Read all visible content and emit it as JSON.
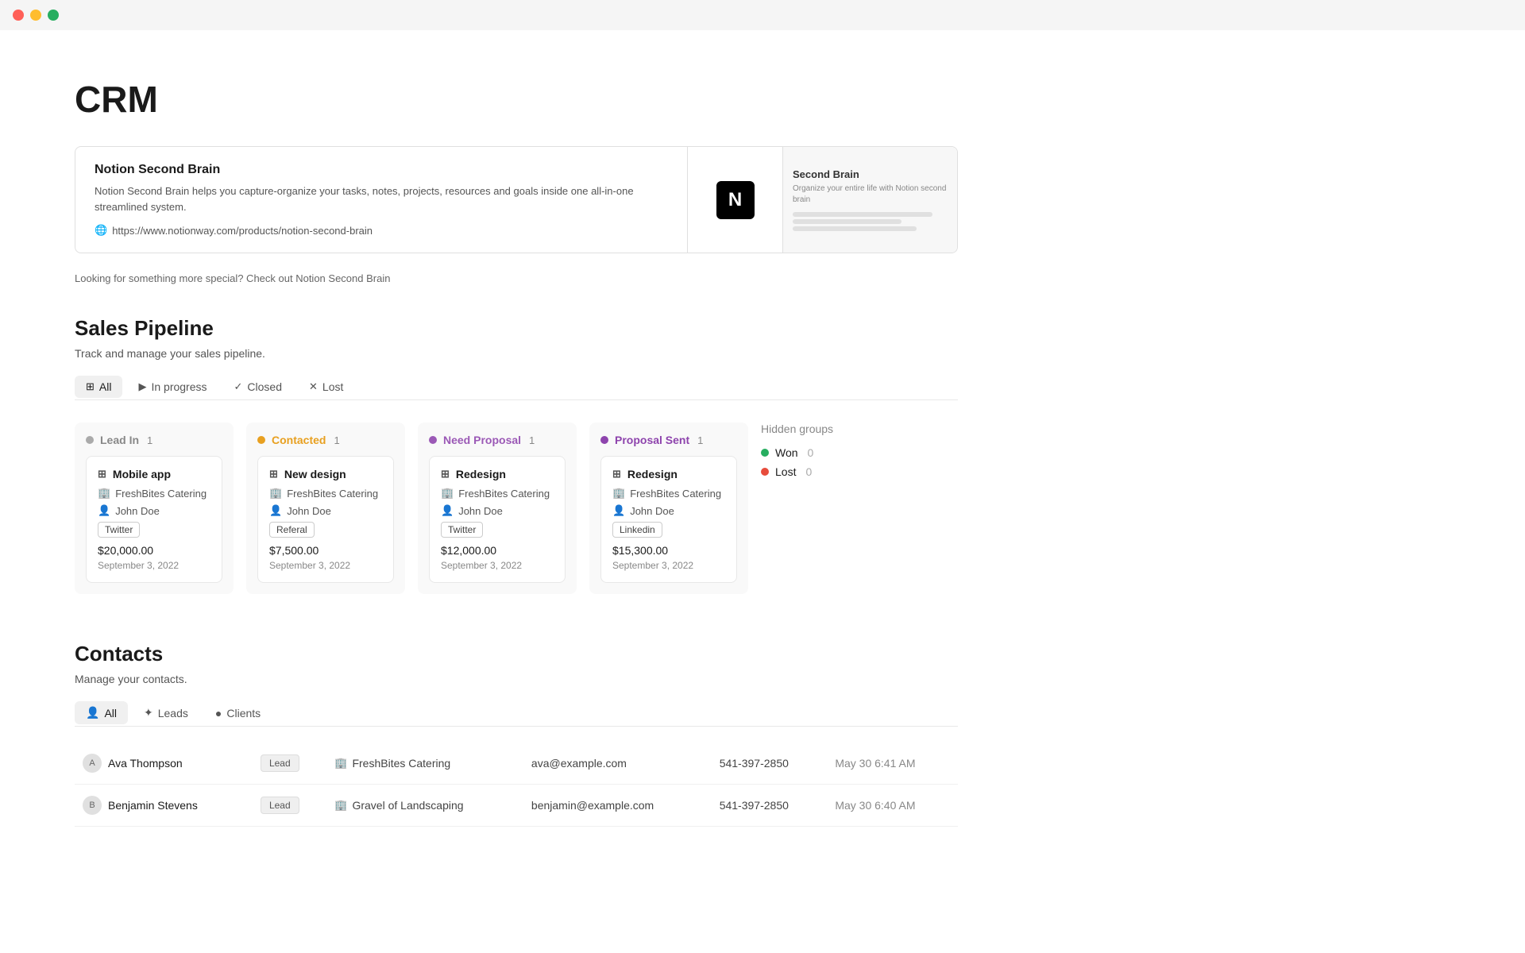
{
  "titlebar": {
    "dots": [
      "red",
      "yellow",
      "green"
    ]
  },
  "page": {
    "title": "CRM"
  },
  "promo": {
    "title": "Notion Second Brain",
    "description": "Notion Second Brain helps you capture-organize your tasks, notes, projects, resources and goals inside one all-in-one streamlined system.",
    "link": "https://www.notionway.com/products/notion-second-brain",
    "preview_title": "Second Brain",
    "preview_subtitle": "Organize your entire life with Notion second brain",
    "note": "Looking for something more special? Check out Notion Second Brain"
  },
  "sales_pipeline": {
    "section_title": "Sales Pipeline",
    "section_desc": "Track and manage your sales pipeline.",
    "tabs": [
      {
        "label": "All",
        "icon": "⊞",
        "active": true
      },
      {
        "label": "In progress",
        "icon": "▶"
      },
      {
        "label": "Closed",
        "icon": "✓"
      },
      {
        "label": "Lost",
        "icon": "✕"
      }
    ],
    "columns": [
      {
        "id": "lead-in",
        "title": "Lead In",
        "count": 1,
        "dot_color": "gray",
        "cards": [
          {
            "title": "Mobile app",
            "company": "FreshBites Catering",
            "person": "John Doe",
            "source": "Twitter",
            "amount": "$20,000.00",
            "date": "September 3, 2022"
          }
        ]
      },
      {
        "id": "contacted",
        "title": "Contacted",
        "count": 1,
        "dot_color": "orange",
        "cards": [
          {
            "title": "New design",
            "company": "FreshBites Catering",
            "person": "John Doe",
            "source": "Referal",
            "amount": "$7,500.00",
            "date": "September 3, 2022"
          }
        ]
      },
      {
        "id": "need-proposal",
        "title": "Need Proposal",
        "count": 1,
        "dot_color": "purple",
        "cards": [
          {
            "title": "Redesign",
            "company": "FreshBites Catering",
            "person": "John Doe",
            "source": "Twitter",
            "amount": "$12,000.00",
            "date": "September 3, 2022"
          }
        ]
      },
      {
        "id": "proposal-sent",
        "title": "Proposal Sent",
        "count": 1,
        "dot_color": "blue-purple",
        "cards": [
          {
            "title": "Redesign",
            "company": "FreshBites Catering",
            "person": "John Doe",
            "source": "Linkedin",
            "amount": "$15,300.00",
            "date": "September 3, 2022"
          }
        ]
      }
    ],
    "hidden_groups": {
      "title": "Hidden groups",
      "items": [
        {
          "label": "Won",
          "dot_color": "green",
          "count": 0
        },
        {
          "label": "Lost",
          "dot_color": "red",
          "count": 0
        }
      ]
    }
  },
  "contacts": {
    "section_title": "Contacts",
    "section_desc": "Manage your contacts.",
    "tabs": [
      {
        "label": "All",
        "icon": "👤",
        "active": true
      },
      {
        "label": "Leads",
        "icon": "✦"
      },
      {
        "label": "Clients",
        "icon": "●"
      }
    ],
    "rows": [
      {
        "name": "Ava Thompson",
        "badge": "Lead",
        "company": "FreshBites Catering",
        "email": "ava@example.com",
        "phone": "541-397-2850",
        "date": "May 30 6:41 AM"
      },
      {
        "name": "Benjamin Stevens",
        "badge": "Lead",
        "company": "Gravel of Landscaping",
        "email": "benjamin@example.com",
        "phone": "541-397-2850",
        "date": "May 30 6:40 AM"
      }
    ]
  }
}
